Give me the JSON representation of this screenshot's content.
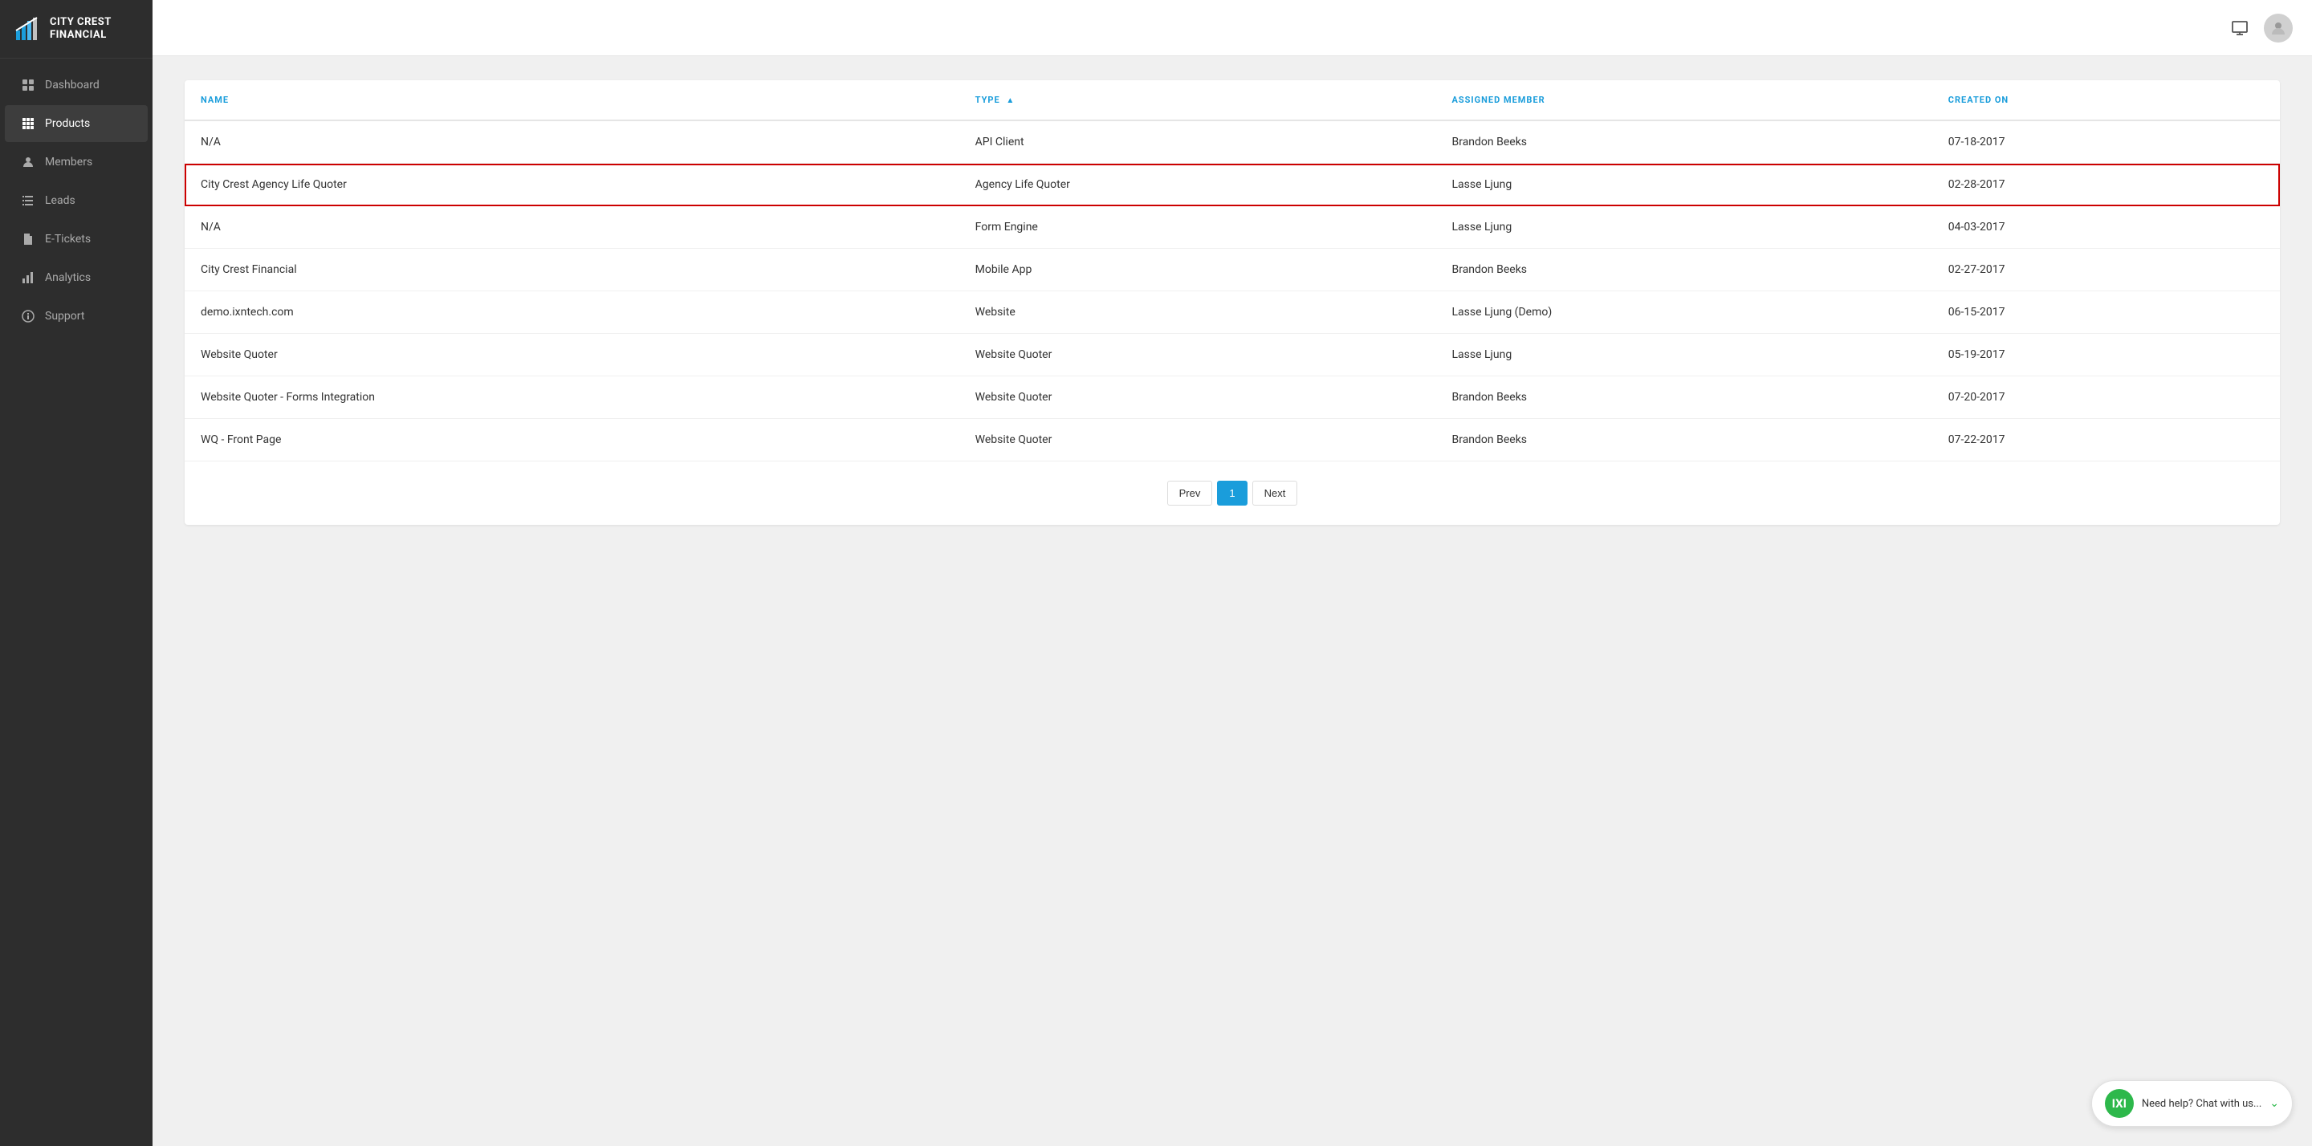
{
  "brand": {
    "name_line1": "CITY CREST",
    "name_line2": "FINANCIAL"
  },
  "sidebar": {
    "items": [
      {
        "id": "dashboard",
        "label": "Dashboard",
        "icon": "grid"
      },
      {
        "id": "products",
        "label": "Products",
        "icon": "apps",
        "active": true
      },
      {
        "id": "members",
        "label": "Members",
        "icon": "person"
      },
      {
        "id": "leads",
        "label": "Leads",
        "icon": "list"
      },
      {
        "id": "etickets",
        "label": "E-Tickets",
        "icon": "file"
      },
      {
        "id": "analytics",
        "label": "Analytics",
        "icon": "bar-chart"
      },
      {
        "id": "support",
        "label": "Support",
        "icon": "info"
      }
    ]
  },
  "table": {
    "columns": [
      {
        "id": "name",
        "label": "NAME",
        "sortable": false
      },
      {
        "id": "type",
        "label": "TYPE",
        "sortable": true,
        "sort_dir": "asc"
      },
      {
        "id": "assigned_member",
        "label": "ASSIGNED MEMBER",
        "sortable": false
      },
      {
        "id": "created_on",
        "label": "CREATED ON",
        "sortable": false
      }
    ],
    "rows": [
      {
        "id": 1,
        "name": "N/A",
        "type": "API Client",
        "assigned_member": "Brandon Beeks",
        "created_on": "07-18-2017",
        "highlighted": false
      },
      {
        "id": 2,
        "name": "City Crest Agency Life Quoter",
        "type": "Agency Life Quoter",
        "assigned_member": "Lasse Ljung",
        "created_on": "02-28-2017",
        "highlighted": true
      },
      {
        "id": 3,
        "name": "N/A",
        "type": "Form Engine",
        "assigned_member": "Lasse Ljung",
        "created_on": "04-03-2017",
        "highlighted": false
      },
      {
        "id": 4,
        "name": "City Crest Financial",
        "type": "Mobile App",
        "assigned_member": "Brandon Beeks",
        "created_on": "02-27-2017",
        "highlighted": false
      },
      {
        "id": 5,
        "name": "demo.ixntech.com",
        "type": "Website",
        "assigned_member": "Lasse Ljung (Demo)",
        "created_on": "06-15-2017",
        "highlighted": false
      },
      {
        "id": 6,
        "name": "Website Quoter",
        "type": "Website Quoter",
        "assigned_member": "Lasse Ljung",
        "created_on": "05-19-2017",
        "highlighted": false
      },
      {
        "id": 7,
        "name": "Website Quoter - Forms Integration",
        "type": "Website Quoter",
        "assigned_member": "Brandon Beeks",
        "created_on": "07-20-2017",
        "highlighted": false
      },
      {
        "id": 8,
        "name": "WQ - Front Page",
        "type": "Website Quoter",
        "assigned_member": "Brandon Beeks",
        "created_on": "07-22-2017",
        "highlighted": false
      }
    ]
  },
  "pagination": {
    "prev_label": "Prev",
    "next_label": "Next",
    "current_page": 1,
    "pages": [
      1
    ]
  },
  "chat": {
    "icon_text": "IXI",
    "label": "Need help? Chat with us..."
  },
  "colors": {
    "accent_blue": "#1a9ddb",
    "sidebar_bg": "#2d2d2d",
    "highlight_red": "#cc0000",
    "chat_green": "#2db84b"
  }
}
